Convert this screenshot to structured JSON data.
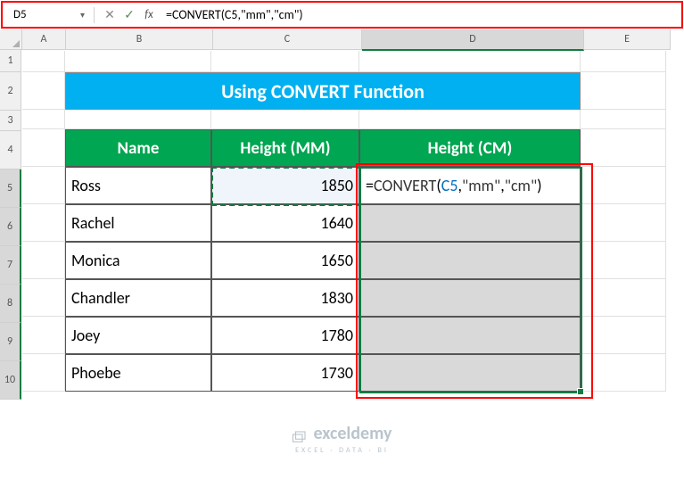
{
  "nameBox": "D5",
  "formulaBar": "=CONVERT(C5,\"mm\",\"cm\")",
  "formulaTokens": {
    "eq": "=",
    "fn": "CONVERT",
    "open": "(",
    "ref": "C5",
    "c1": ",",
    "s1": "\"mm\"",
    "c2": ",",
    "s2": "\"cm\"",
    "close": ")"
  },
  "columns": {
    "A": "A",
    "B": "B",
    "C": "C",
    "D": "D",
    "E": "E"
  },
  "rows": [
    "1",
    "2",
    "3",
    "4",
    "5",
    "6",
    "7",
    "8",
    "9",
    "10"
  ],
  "title": "Using CONVERT Function",
  "headers": {
    "name": "Name",
    "mm": "Height (MM)",
    "cm": "Height (CM)"
  },
  "data": [
    {
      "name": "Ross",
      "mm": "1850"
    },
    {
      "name": "Rachel",
      "mm": "1640"
    },
    {
      "name": "Monica",
      "mm": "1650"
    },
    {
      "name": "Chandler",
      "mm": "1830"
    },
    {
      "name": "Joey",
      "mm": "1780"
    },
    {
      "name": "Phoebe",
      "mm": "1730"
    }
  ],
  "watermark": {
    "brand": "exceldemy",
    "tagline": "EXCEL · DATA · BI"
  }
}
